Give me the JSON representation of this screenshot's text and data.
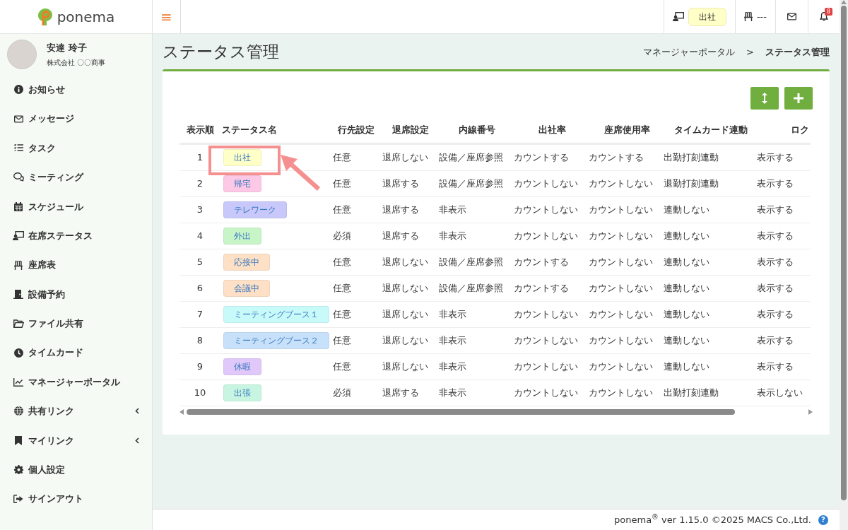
{
  "brand": {
    "name": "ponema"
  },
  "topbar": {
    "menu_glyph": "≡",
    "status_badge": "出社",
    "seat_text": "---",
    "notification_count": "8"
  },
  "user": {
    "name": "安達 玲子",
    "company": "株式会社 〇〇商事"
  },
  "sidebar": {
    "items": [
      {
        "label": "お知らせ",
        "has_submenu": false
      },
      {
        "label": "メッセージ",
        "has_submenu": false
      },
      {
        "label": "タスク",
        "has_submenu": false
      },
      {
        "label": "ミーティング",
        "has_submenu": false
      },
      {
        "label": "スケジュール",
        "has_submenu": false
      },
      {
        "label": "在席ステータス",
        "has_submenu": false
      },
      {
        "label": "座席表",
        "has_submenu": false
      },
      {
        "label": "設備予約",
        "has_submenu": false
      },
      {
        "label": "ファイル共有",
        "has_submenu": false
      },
      {
        "label": "タイムカード",
        "has_submenu": false
      },
      {
        "label": "マネージャーポータル",
        "has_submenu": false
      },
      {
        "label": "共有リンク",
        "has_submenu": true
      },
      {
        "label": "マイリンク",
        "has_submenu": true
      },
      {
        "label": "個人設定",
        "has_submenu": false
      },
      {
        "label": "サインアウト",
        "has_submenu": false
      }
    ]
  },
  "page": {
    "title": "ステータス管理",
    "breadcrumb": [
      "マネージャーポータル",
      "ステータス管理"
    ],
    "breadcrumb_separator": ">"
  },
  "table": {
    "columns": [
      "表示順",
      "ステータス名",
      "行先設定",
      "退席設定",
      "内線番号",
      "出社率",
      "座席使用率",
      "タイムカード連動",
      "ロク"
    ],
    "rows": [
      {
        "color": "#ffffc8",
        "cells": [
          "1",
          "出社",
          "任意",
          "退席しない",
          "設備／座席参照",
          "カウントする",
          "カウントする",
          "出勤打刻連動",
          "表示する"
        ],
        "highlighted": true
      },
      {
        "color": "#fcc8e6",
        "cells": [
          "2",
          "帰宅",
          "任意",
          "退席する",
          "設備／座席参照",
          "カウントしない",
          "カウントしない",
          "退勤打刻連動",
          "表示する"
        ],
        "highlighted": false
      },
      {
        "color": "#c8c8fa",
        "cells": [
          "3",
          "テレワーク",
          "任意",
          "退席する",
          "非表示",
          "カウントしない",
          "カウントしない",
          "連動しない",
          "表示する"
        ],
        "highlighted": false
      },
      {
        "color": "#c8f5c8",
        "cells": [
          "4",
          "外出",
          "必須",
          "退席する",
          "非表示",
          "カウントしない",
          "カウントしない",
          "連動しない",
          "表示する"
        ],
        "highlighted": false
      },
      {
        "color": "#fde0c5",
        "cells": [
          "5",
          "応接中",
          "任意",
          "退席しない",
          "設備／座席参照",
          "カウントする",
          "カウントしない",
          "連動しない",
          "表示する"
        ],
        "highlighted": false
      },
      {
        "color": "#fde0c5",
        "cells": [
          "6",
          "会議中",
          "任意",
          "退席しない",
          "設備／座席参照",
          "カウントする",
          "カウントしない",
          "連動しない",
          "表示する"
        ],
        "highlighted": false
      },
      {
        "color": "#c8fafa",
        "cells": [
          "7",
          "ミーティングブース１",
          "任意",
          "退席しない",
          "非表示",
          "カウントしない",
          "カウントしない",
          "連動しない",
          "表示する"
        ],
        "highlighted": false
      },
      {
        "color": "#c8e1fa",
        "cells": [
          "8",
          "ミーティングブース２",
          "任意",
          "退席しない",
          "非表示",
          "カウントしない",
          "カウントしない",
          "連動しない",
          "表示する"
        ],
        "highlighted": false
      },
      {
        "color": "#e1c8fa",
        "cells": [
          "9",
          "休暇",
          "任意",
          "退席しない",
          "非表示",
          "カウントしない",
          "カウントしない",
          "連動しない",
          "表示する"
        ],
        "highlighted": false
      },
      {
        "color": "#c8f5e1",
        "cells": [
          "10",
          "出張",
          "必須",
          "退席する",
          "非表示",
          "カウントしない",
          "カウントしない",
          "出勤打刻連動",
          "表示しない"
        ],
        "highlighted": false
      }
    ]
  },
  "footer": {
    "text": "ponema$^{®}$ ver 1.15.0 ©2025 MACS Co.,Ltd.",
    "help_glyph": "?"
  }
}
